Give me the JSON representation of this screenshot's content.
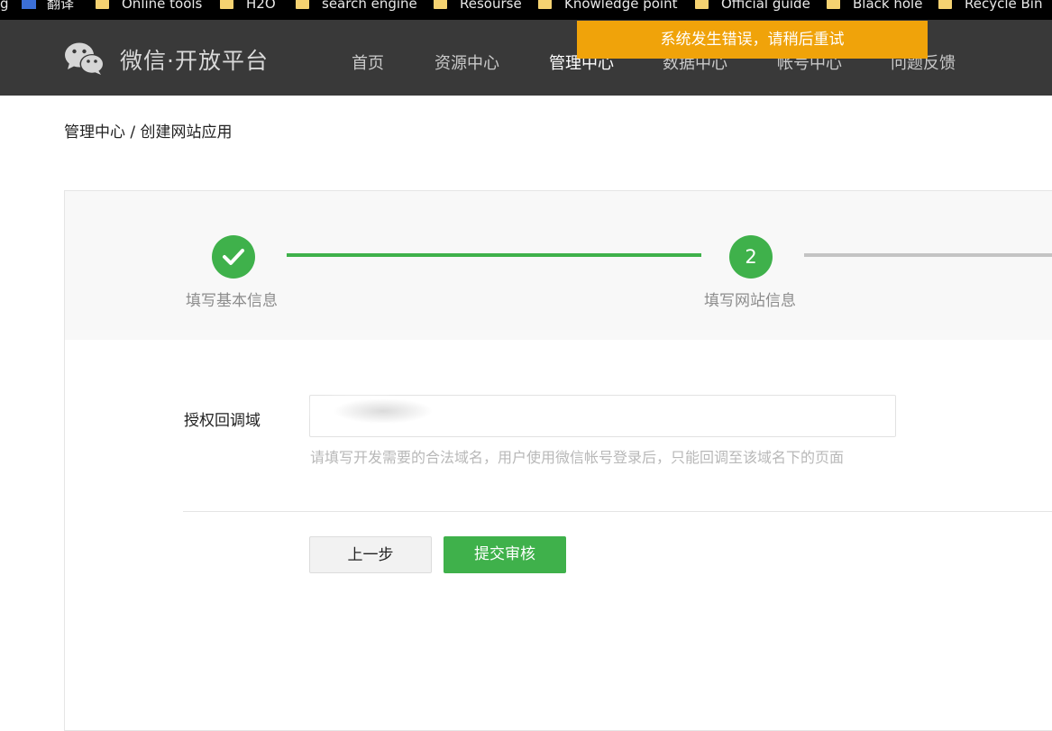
{
  "bookmarks": [
    {
      "label": "翻译",
      "icon": "translate-icon"
    },
    {
      "label": "Online tools",
      "icon": "folder-icon"
    },
    {
      "label": "H2O",
      "icon": "folder-icon"
    },
    {
      "label": "search engine",
      "icon": "folder-icon"
    },
    {
      "label": "Resourse",
      "icon": "folder-icon"
    },
    {
      "label": "Knowledge point",
      "icon": "folder-icon"
    },
    {
      "label": "Official guide",
      "icon": "folder-icon"
    },
    {
      "label": "Black hole",
      "icon": "folder-icon"
    },
    {
      "label": "Recycle Bin",
      "icon": "folder-icon"
    }
  ],
  "header": {
    "logo_text": "微信·开放平台",
    "logo_icon": "wechat-icon",
    "nav": [
      "首页",
      "资源中心",
      "管理中心",
      "数据中心",
      "帐号中心",
      "问题反馈"
    ],
    "active_nav": "管理中心",
    "background": "#393939"
  },
  "toast": {
    "message": "系统发生错误，请稍后重试",
    "color": "#f0a30a"
  },
  "breadcrumb": "管理中心 / 创建网站应用",
  "steps": [
    {
      "label": "填写基本信息",
      "status": "done",
      "icon": "checkmark-icon"
    },
    {
      "label": "填写网站信息",
      "status": "current",
      "number": "2"
    }
  ],
  "form": {
    "label": "授权回调域",
    "value": "",
    "help": "请填写开发需要的合法域名，用户使用微信帐号登录后，只能回调至该域名下的页面"
  },
  "buttons": {
    "prev": "上一步",
    "submit": "提交审核"
  },
  "colors": {
    "accent_green": "#3fb14b",
    "pending_line": "#c4c4c4"
  }
}
